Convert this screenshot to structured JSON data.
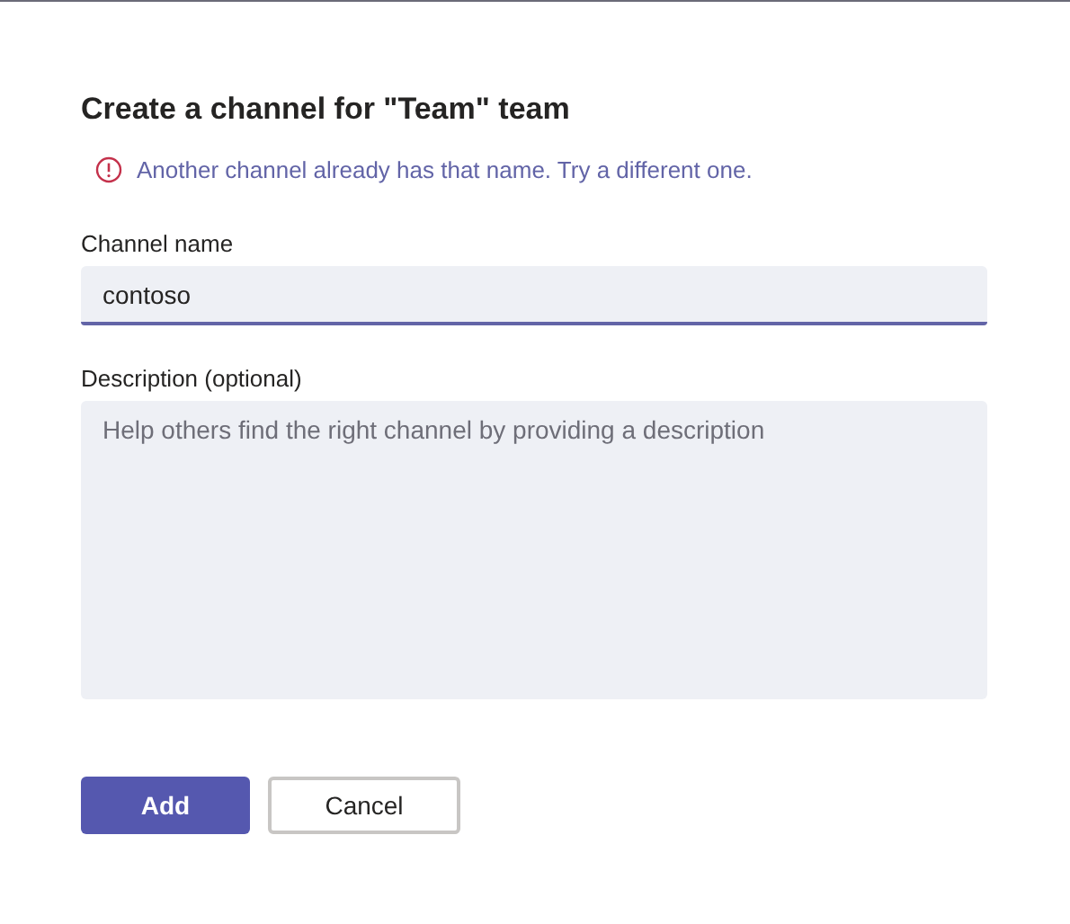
{
  "dialog": {
    "title": "Create a channel for \"Team\" team"
  },
  "error": {
    "message": "Another channel already has that name. Try a different one."
  },
  "channel_name": {
    "label": "Channel name",
    "value": "contoso"
  },
  "description": {
    "label": "Description (optional)",
    "placeholder": "Help others find the right channel by providing a description"
  },
  "buttons": [
    {
      "label": "Add",
      "kind": "primary"
    },
    {
      "label": "Cancel",
      "kind": "secondary"
    }
  ]
}
